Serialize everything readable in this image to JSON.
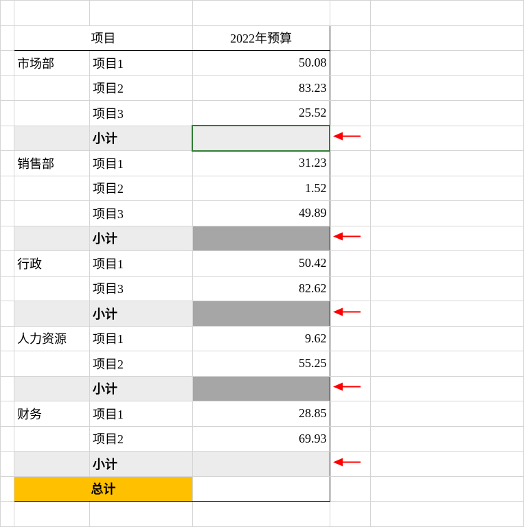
{
  "header": {
    "project": "项目",
    "budget": "2022年预算"
  },
  "labels": {
    "subtotal": "小计",
    "total": "总计"
  },
  "sections": [
    {
      "dept": "市场部",
      "rows": [
        {
          "name": "项目1",
          "value": "50.08"
        },
        {
          "name": "项目2",
          "value": "83.23"
        },
        {
          "name": "项目3",
          "value": "25.52"
        }
      ],
      "subtotal_style": "active"
    },
    {
      "dept": "销售部",
      "rows": [
        {
          "name": "项目1",
          "value": "31.23"
        },
        {
          "name": "项目2",
          "value": "1.52"
        },
        {
          "name": "项目3",
          "value": "49.89"
        }
      ],
      "subtotal_style": "gray"
    },
    {
      "dept": "行政",
      "rows": [
        {
          "name": "项目1",
          "value": "50.42"
        },
        {
          "name": "项目3",
          "value": "82.62"
        }
      ],
      "subtotal_style": "gray"
    },
    {
      "dept": "人力资源",
      "rows": [
        {
          "name": "项目1",
          "value": "9.62"
        },
        {
          "name": "项目2",
          "value": "55.25"
        }
      ],
      "subtotal_style": "gray"
    },
    {
      "dept": "财务",
      "rows": [
        {
          "name": "项目1",
          "value": "28.85"
        },
        {
          "name": "项目2",
          "value": "69.93"
        }
      ],
      "subtotal_style": "light"
    }
  ]
}
